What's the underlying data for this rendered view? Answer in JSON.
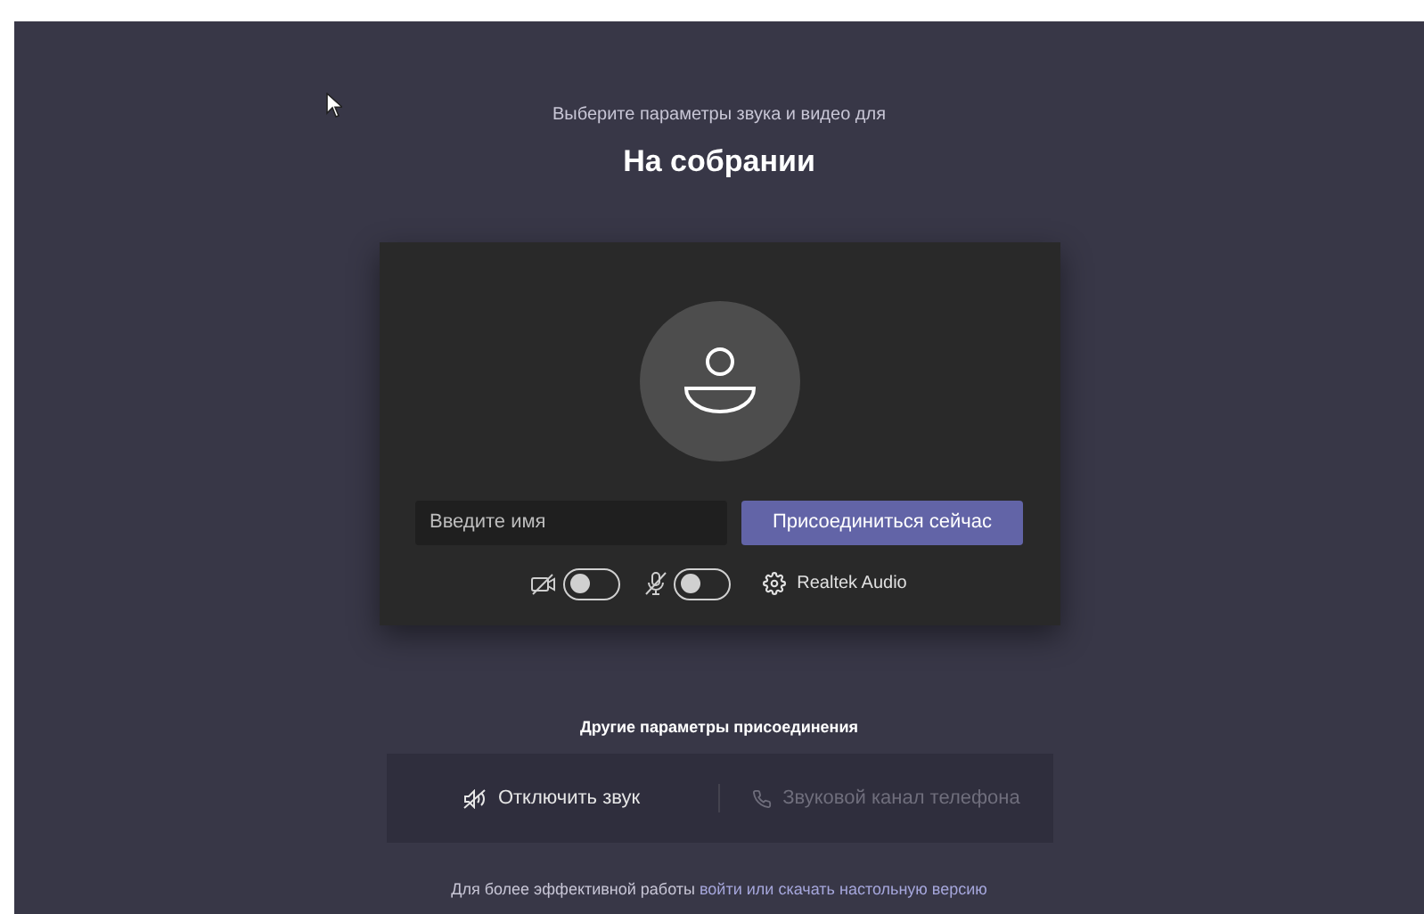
{
  "header": {
    "subtitle": "Выберите параметры звука и видео для",
    "title": "На собрании"
  },
  "name_field": {
    "placeholder": "Введите имя"
  },
  "join_button": "Присоединиться сейчас",
  "toggles": [
    {
      "kind": "camera",
      "on": false
    },
    {
      "kind": "microphone",
      "on": false
    }
  ],
  "audio_device": "Realtek Audio",
  "other_options": {
    "title": "Другие параметры присоединения",
    "options": [
      {
        "kind": "mute",
        "label": "Отключить звук",
        "disabled": false
      },
      {
        "kind": "phone",
        "label": "Звуковой канал телефона",
        "disabled": true
      }
    ]
  },
  "footer": {
    "text": "Для более эффективной работы",
    "link_1": "войти",
    "middle": "или",
    "link_2": "скачать настольную версию"
  }
}
